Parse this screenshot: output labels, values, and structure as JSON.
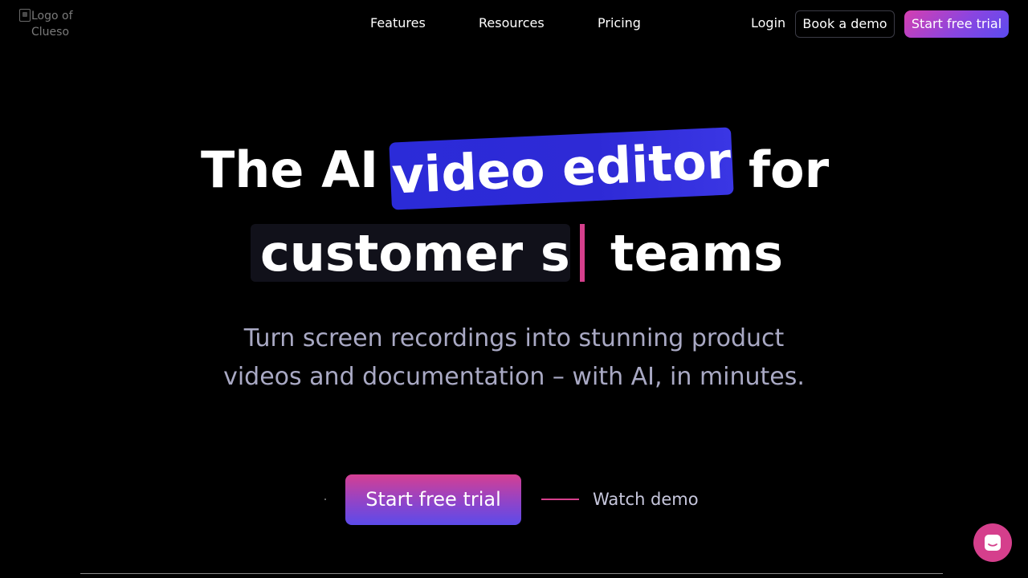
{
  "nav": {
    "logo_alt": "Logo of Clueso",
    "links": [
      "Features",
      "Resources",
      "Pricing"
    ],
    "login": "Login",
    "book_demo": "Book a demo",
    "start_trial": "Start free trial"
  },
  "hero": {
    "line1_start": "The AI",
    "highlight": "video editor",
    "line1_end": "for",
    "typed": "customer s",
    "line2_end": "teams",
    "subtitle": "Turn screen recordings into stunning product videos and documentation – with AI, in minutes.",
    "cta_primary": "Start free trial",
    "cta_secondary": "Watch demo"
  },
  "colors": {
    "background": "#000000",
    "accent_pink": "#d53f8c",
    "accent_blue": "#2e2ad6",
    "subtitle": "#a9a9c4"
  },
  "icons": {
    "chat": "chat-bubble-icon"
  }
}
